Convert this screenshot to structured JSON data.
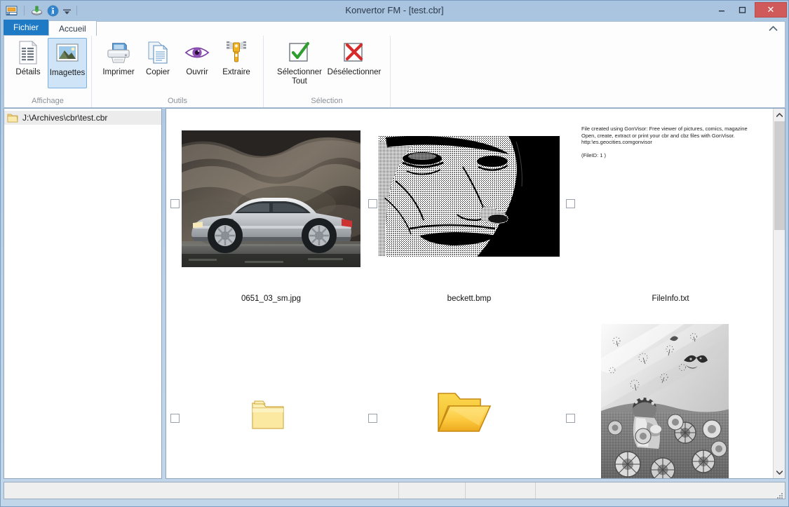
{
  "window": {
    "title": "Konvertor FM - [test.cbr]",
    "minimize_label": "–",
    "maximize_label": "☐",
    "close_label": "✕",
    "accent_blue": "#1e7ac4",
    "close_red": "#d05a5a",
    "titlebar_bg": "#b0c9e3"
  },
  "quick_access": {
    "items": [
      {
        "name": "app-icon",
        "title": "Konvertor"
      },
      {
        "name": "save-icon",
        "title": "Enregistrer"
      },
      {
        "name": "info-icon",
        "title": "Informations"
      },
      {
        "name": "customize-chevron-icon",
        "title": "Personnaliser"
      }
    ]
  },
  "tabs": {
    "file_label": "Fichier",
    "home_label": "Accueil",
    "collapse_label": "⌃"
  },
  "ribbon": {
    "groups": [
      {
        "label": "Affichage",
        "buttons": [
          {
            "label": "Détails",
            "icon": "details-list-icon",
            "selected": false
          },
          {
            "label": "Imagettes",
            "icon": "thumbnails-picture-icon",
            "selected": true
          }
        ]
      },
      {
        "label": "Outils",
        "buttons": [
          {
            "label": "Imprimer",
            "icon": "printer-icon",
            "selected": false
          },
          {
            "label": "Copier",
            "icon": "copy-documents-icon",
            "selected": false
          },
          {
            "label": "Ouvrir",
            "icon": "eye-open-icon",
            "selected": false
          },
          {
            "label": "Extraire",
            "icon": "zipper-extract-icon",
            "selected": false
          }
        ]
      },
      {
        "label": "Sélection",
        "buttons": [
          {
            "label": "Sélectionner Tout",
            "icon": "checkbox-green-check-icon",
            "selected": false
          },
          {
            "label": "Désélectionner",
            "icon": "checkbox-red-cross-icon",
            "selected": false
          }
        ]
      }
    ]
  },
  "sidebar": {
    "items": [
      {
        "label": "J:\\Archives\\cbr\\test.cbr",
        "icon": "folder-icon",
        "selected": true
      }
    ]
  },
  "content": {
    "items": [
      {
        "name": "thumbnail-car-photo",
        "filename": "0651_03_sm.jpg",
        "kind": "image-car",
        "checked": false
      },
      {
        "name": "thumbnail-beckett-portrait",
        "filename": "beckett.bmp",
        "kind": "image-portrait",
        "checked": false
      },
      {
        "name": "thumbnail-fileinfo-text",
        "filename": "FileInfo.txt",
        "kind": "text",
        "checked": false,
        "text_lines": [
          "File created using GonVisor: Free viewer of pictures, comics, magazine",
          "Open, create, extract or print your cbr and cbz files with GonVisor.",
          "http:\\es.geocities.comgonvisor",
          "",
          "(FileID: 1 )"
        ]
      },
      {
        "name": "thumbnail-folder-closed",
        "filename": "",
        "kind": "folder-closed",
        "checked": false
      },
      {
        "name": "thumbnail-folder-open",
        "filename": "",
        "kind": "folder-open",
        "checked": false
      },
      {
        "name": "thumbnail-flower-illustration",
        "filename": "",
        "kind": "image-illustration",
        "checked": false
      }
    ]
  },
  "scrollbar": {
    "up_label": "⌃",
    "down_label": "⌄"
  },
  "statusbar": {
    "panels": [
      "",
      "",
      "",
      ""
    ]
  }
}
